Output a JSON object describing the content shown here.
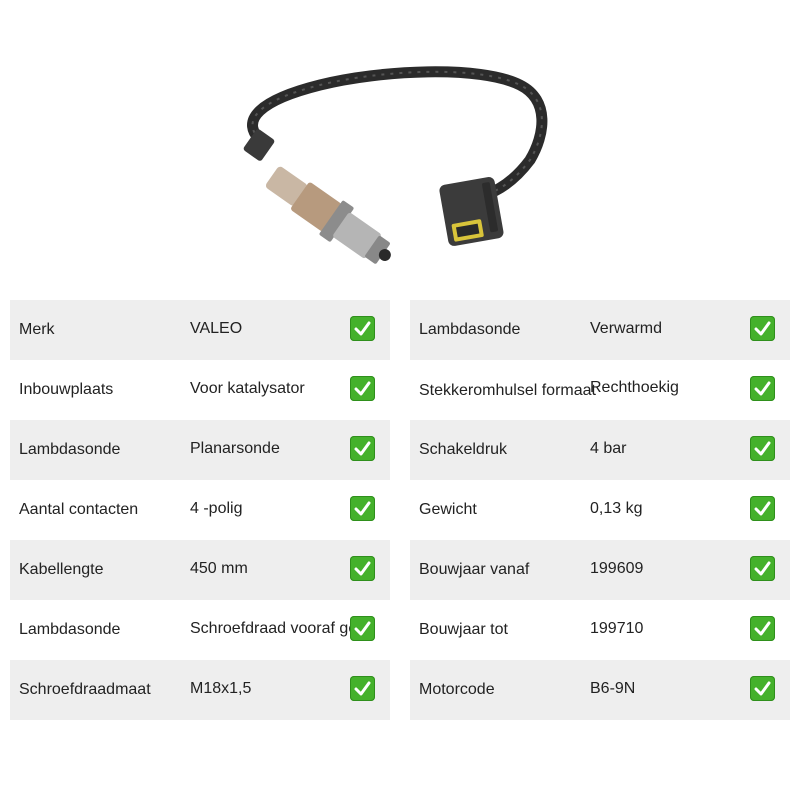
{
  "colors": {
    "shaded_row": "#eeeeee",
    "check_green": "#44b12b"
  },
  "product": {
    "image_icon": "lambda-sensor-image"
  },
  "specs_left": [
    {
      "label": "Merk",
      "value": "VALEO"
    },
    {
      "label": "Inbouwplaats",
      "value": "Voor katalysator"
    },
    {
      "label": "Lambdasonde",
      "value": "Planarsonde"
    },
    {
      "label": "Aantal contacten",
      "value": "4 -polig"
    },
    {
      "label": "Kabellengte",
      "value": "450 mm"
    },
    {
      "label": "Lambdasonde",
      "value": "Schroefdraad vooraf gev"
    },
    {
      "label": "Schroefdraadmaat",
      "value": "M18x1,5"
    }
  ],
  "specs_right": [
    {
      "label": "Lambdasonde",
      "value": "Verwarmd"
    },
    {
      "label": "Stekkeromhulsel formaat",
      "value": "Rechthoekig"
    },
    {
      "label": "Schakeldruk",
      "value": "4 bar"
    },
    {
      "label": "Gewicht",
      "value": "0,13 kg"
    },
    {
      "label": "Bouwjaar vanaf",
      "value": "199609"
    },
    {
      "label": "Bouwjaar tot",
      "value": "199710"
    },
    {
      "label": "Motorcode",
      "value": "B6-9N"
    }
  ]
}
